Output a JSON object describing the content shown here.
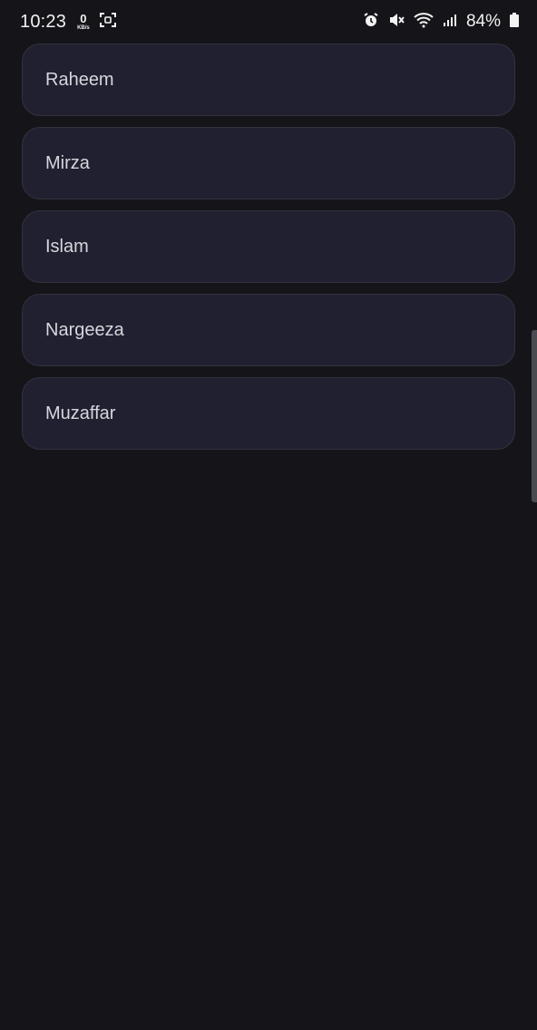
{
  "status_bar": {
    "time": "10:23",
    "net_speed_value": "0",
    "net_speed_unit": "KB/s",
    "battery_percent": "84%",
    "icons": [
      "screenshot-icon",
      "alarm-icon",
      "mute-icon",
      "wifi-icon",
      "signal-icon",
      "battery-icon"
    ]
  },
  "names": {
    "items": [
      {
        "label": "Raheem"
      },
      {
        "label": "Mirza"
      },
      {
        "label": "Islam"
      },
      {
        "label": "Nargeeza"
      },
      {
        "label": "Muzaffar"
      }
    ]
  },
  "colors": {
    "background": "#141419",
    "card": "#202030",
    "card_border": "#32323f",
    "text": "#d6d6de"
  }
}
